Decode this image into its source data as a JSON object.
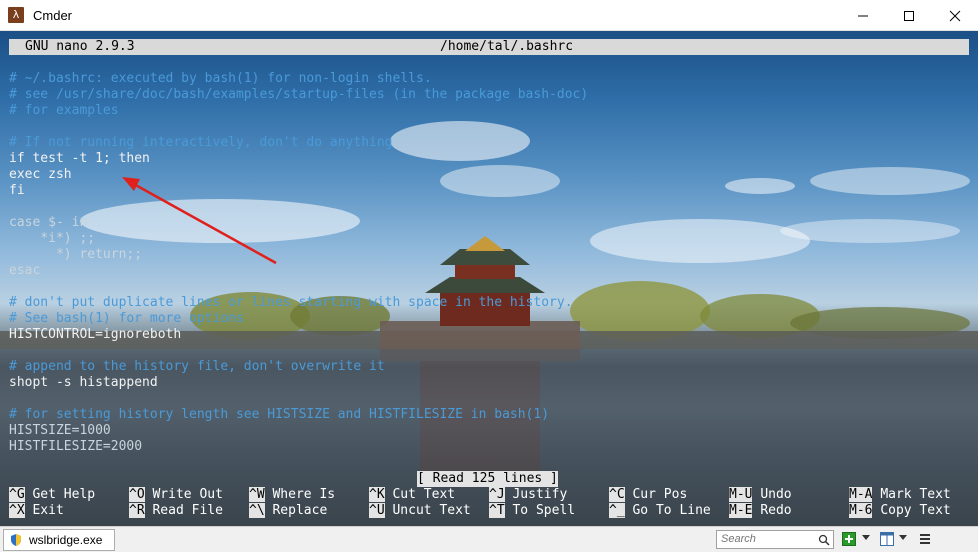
{
  "window": {
    "title": "Cmder",
    "icon_glyph": "λ"
  },
  "nano": {
    "version": "GNU nano 2.9.3",
    "file": "/home/tal/.bashrc",
    "lines": [
      {
        "text": "# ~/.bashrc: executed by bash(1) for non-login shells.",
        "kind": "comment"
      },
      {
        "text": "# see /usr/share/doc/bash/examples/startup-files (in the package bash-doc)",
        "kind": "comment"
      },
      {
        "text": "# for examples",
        "kind": "comment"
      },
      {
        "text": "",
        "kind": "blank"
      },
      {
        "text": "# If not running interactively, don't do anything",
        "kind": "comment"
      },
      {
        "text": "if test -t 1; then",
        "kind": "code"
      },
      {
        "text": "exec zsh",
        "kind": "code"
      },
      {
        "text": "fi",
        "kind": "code"
      },
      {
        "text": "",
        "kind": "blank"
      },
      {
        "text": "case $- in",
        "kind": "dim"
      },
      {
        "text": "    *i*) ;;",
        "kind": "dim"
      },
      {
        "text": "      *) return;;",
        "kind": "dim"
      },
      {
        "text": "esac",
        "kind": "dim"
      },
      {
        "text": "",
        "kind": "blank"
      },
      {
        "text": "# don't put duplicate lines or lines starting with space in the history.",
        "kind": "comment"
      },
      {
        "text": "# See bash(1) for more options",
        "kind": "comment"
      },
      {
        "text": "HISTCONTROL=ignoreboth",
        "kind": "code"
      },
      {
        "text": "",
        "kind": "blank"
      },
      {
        "text": "# append to the history file, don't overwrite it",
        "kind": "comment"
      },
      {
        "text": "shopt -s histappend",
        "kind": "code"
      },
      {
        "text": "",
        "kind": "blank"
      },
      {
        "text": "# for setting history length see HISTSIZE and HISTFILESIZE in bash(1)",
        "kind": "comment"
      },
      {
        "text": "HISTSIZE=1000",
        "kind": "dim"
      },
      {
        "text": "HISTFILESIZE=2000",
        "kind": "dim"
      }
    ],
    "status": "[ Read 125 lines ]",
    "shortcuts": [
      {
        "key": "^G",
        "label": "Get Help",
        "col": 0,
        "row": 0
      },
      {
        "key": "^O",
        "label": "Write Out",
        "col": 1,
        "row": 0
      },
      {
        "key": "^W",
        "label": "Where Is",
        "col": 2,
        "row": 0
      },
      {
        "key": "^K",
        "label": "Cut Text",
        "col": 3,
        "row": 0
      },
      {
        "key": "^J",
        "label": "Justify",
        "col": 4,
        "row": 0
      },
      {
        "key": "^C",
        "label": "Cur Pos",
        "col": 5,
        "row": 0
      },
      {
        "key": "M-U",
        "label": "Undo",
        "col": 6,
        "row": 0
      },
      {
        "key": "M-A",
        "label": "Mark Text",
        "col": 7,
        "row": 0
      },
      {
        "key": "^X",
        "label": "Exit",
        "col": 0,
        "row": 1
      },
      {
        "key": "^R",
        "label": "Read File",
        "col": 1,
        "row": 1
      },
      {
        "key": "^\\",
        "label": "Replace",
        "col": 2,
        "row": 1
      },
      {
        "key": "^U",
        "label": "Uncut Text",
        "col": 3,
        "row": 1
      },
      {
        "key": "^T",
        "label": "To Spell",
        "col": 4,
        "row": 1
      },
      {
        "key": "^_",
        "label": "Go To Line",
        "col": 5,
        "row": 1
      },
      {
        "key": "M-E",
        "label": "Redo",
        "col": 6,
        "row": 1
      },
      {
        "key": "M-6",
        "label": "Copy Text",
        "col": 7,
        "row": 1
      }
    ]
  },
  "bottom_bar": {
    "tab_label": "wslbridge.exe",
    "search_placeholder": "Search"
  },
  "colors": {
    "annotation_arrow": "#e0201c",
    "comment": "#4a9ad8"
  }
}
